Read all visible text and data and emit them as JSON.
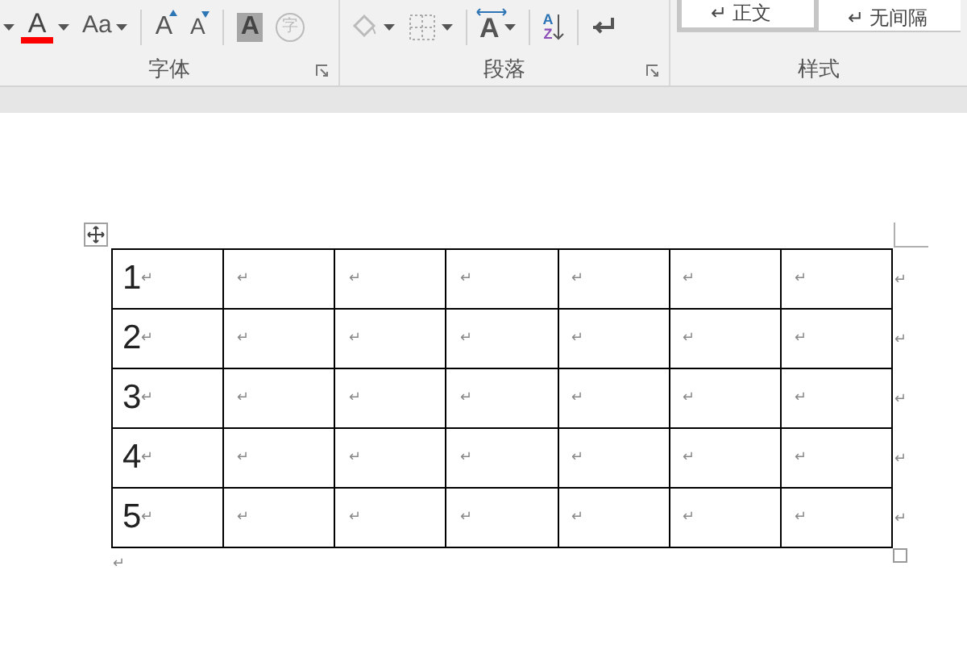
{
  "ribbon": {
    "groups": [
      {
        "label": "字体",
        "launcher": true,
        "tools": [
          {
            "kind": "caret"
          },
          {
            "kind": "font-color",
            "glyph": "A",
            "dropdown": true
          },
          {
            "kind": "change-case",
            "glyph": "Aa",
            "dropdown": true
          },
          {
            "kind": "separator"
          },
          {
            "kind": "grow-font",
            "glyph": "A",
            "dropdown": false
          },
          {
            "kind": "shrink-font",
            "glyph": "A",
            "dropdown": false
          },
          {
            "kind": "separator"
          },
          {
            "kind": "char-shading",
            "glyph": "A",
            "dropdown": false
          },
          {
            "kind": "enclose",
            "glyph": "字",
            "dropdown": false
          }
        ]
      },
      {
        "label": "段落",
        "launcher": true,
        "tools": [
          {
            "kind": "paint-bucket",
            "dropdown": true
          },
          {
            "kind": "borders",
            "dropdown": true
          },
          {
            "kind": "separator"
          },
          {
            "kind": "asian-layout",
            "glyph": "A",
            "dropdown": true
          },
          {
            "kind": "separator"
          },
          {
            "kind": "sort",
            "glyph": "A",
            "glyph2": "Z",
            "dropdown": false
          },
          {
            "kind": "separator"
          },
          {
            "kind": "show-marks",
            "dropdown": false
          }
        ]
      },
      {
        "label": "样式",
        "launcher": false,
        "styles": [
          {
            "mark": "↵",
            "name": "正文",
            "selected": true
          },
          {
            "mark": "↵",
            "name": "无间隔",
            "selected": false
          }
        ]
      }
    ]
  },
  "table": {
    "rows": [
      {
        "cells": [
          {
            "text": "1",
            "mark": "↵"
          },
          {
            "mark": "↵"
          },
          {
            "mark": "↵"
          },
          {
            "mark": "↵"
          },
          {
            "mark": "↵"
          },
          {
            "mark": "↵"
          },
          {
            "mark": "↵"
          }
        ],
        "end_mark": "↵"
      },
      {
        "cells": [
          {
            "text": "2",
            "mark": "↵"
          },
          {
            "mark": "↵"
          },
          {
            "mark": "↵"
          },
          {
            "mark": "↵"
          },
          {
            "mark": "↵"
          },
          {
            "mark": "↵"
          },
          {
            "mark": "↵"
          }
        ],
        "end_mark": "↵"
      },
      {
        "cells": [
          {
            "text": "3",
            "mark": "↵"
          },
          {
            "mark": "↵"
          },
          {
            "mark": "↵"
          },
          {
            "mark": "↵"
          },
          {
            "mark": "↵"
          },
          {
            "mark": "↵"
          },
          {
            "mark": "↵"
          }
        ],
        "end_mark": "↵"
      },
      {
        "cells": [
          {
            "text": "4",
            "mark": "↵"
          },
          {
            "mark": "↵"
          },
          {
            "mark": "↵"
          },
          {
            "mark": "↵"
          },
          {
            "mark": "↵"
          },
          {
            "mark": "↵"
          },
          {
            "mark": "↵"
          }
        ],
        "end_mark": "↵"
      },
      {
        "cells": [
          {
            "text": "5",
            "mark": "↵"
          },
          {
            "mark": "↵"
          },
          {
            "mark": "↵"
          },
          {
            "mark": "↵"
          },
          {
            "mark": "↵"
          },
          {
            "mark": "↵"
          },
          {
            "mark": "↵"
          }
        ],
        "end_mark": "↵"
      }
    ]
  },
  "after_table_mark": "↵"
}
